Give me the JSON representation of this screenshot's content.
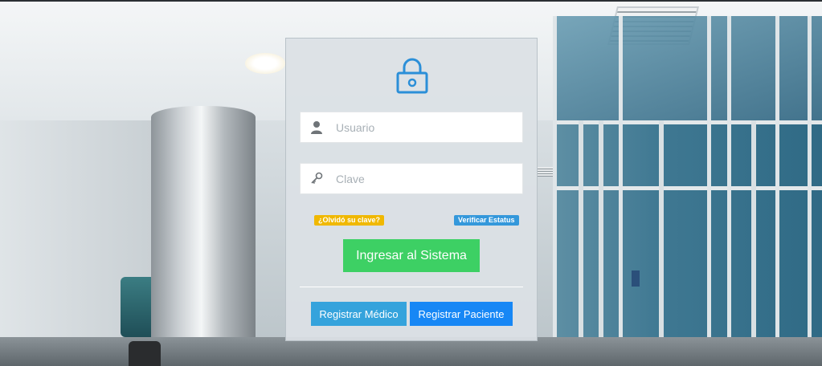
{
  "login": {
    "username": {
      "placeholder": "Usuario",
      "icon": "user-icon"
    },
    "password": {
      "placeholder": "Clave",
      "icon": "key-icon"
    },
    "forgot_label": "¿Olvidó su clave?",
    "status_label": "Verificar Estatus",
    "submit_label": "Ingresar al Sistema",
    "register_doctor_label": "Registrar Médico",
    "register_patient_label": "Registrar Paciente",
    "header_icon": "lock-icon"
  },
  "colors": {
    "accent_blue": "#2b8fd8",
    "forgot_badge": "#f0b800",
    "status_badge": "#3498db",
    "submit_green": "#3dd064",
    "doctor_button": "#35a3dc",
    "patient_button": "#1787f5"
  }
}
